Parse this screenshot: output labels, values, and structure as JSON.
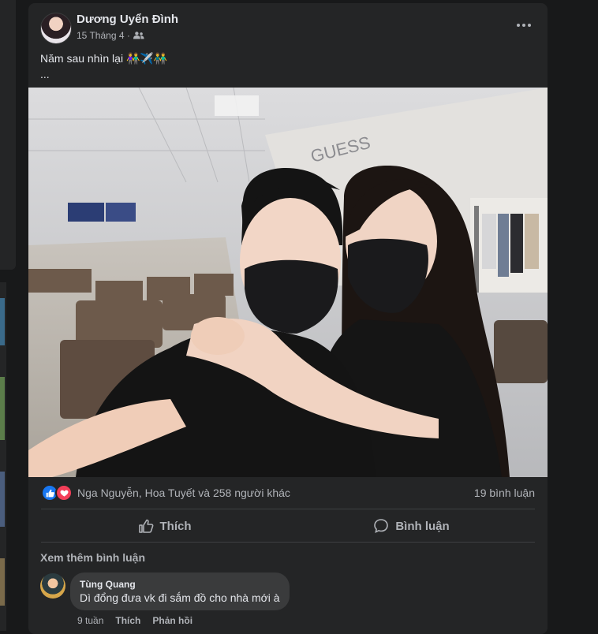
{
  "post": {
    "author": "Dương Uyển Đình",
    "date": "15 Tháng 4 ·",
    "audience_icon": "friends-icon",
    "caption_line1": "Năm sau nhìn lại 👫✈️👬",
    "caption_line2": "...",
    "photo": {
      "sign_text": "GUESS"
    }
  },
  "reactions": {
    "icons": [
      "like-icon",
      "love-icon"
    ],
    "summary": "Nga Nguyễn, Hoa Tuyết và 258 người khác",
    "comment_count": "19 bình luận"
  },
  "actions": {
    "like_label": "Thích",
    "comment_label": "Bình luận"
  },
  "comments": {
    "view_more": "Xem thêm bình luận",
    "items": [
      {
        "name": "Tùng Quang",
        "text": "Dì đổng đưa vk đi sắm đồ cho nhà mới à",
        "time": "9 tuần",
        "like": "Thích",
        "reply": "Phản hồi"
      }
    ]
  },
  "colors": {
    "background": "#18191a",
    "card": "#242526",
    "text_primary": "#e4e6eb",
    "text_secondary": "#b0b3b8",
    "like_blue": "#1877f2",
    "love_red": "#f33e58"
  }
}
